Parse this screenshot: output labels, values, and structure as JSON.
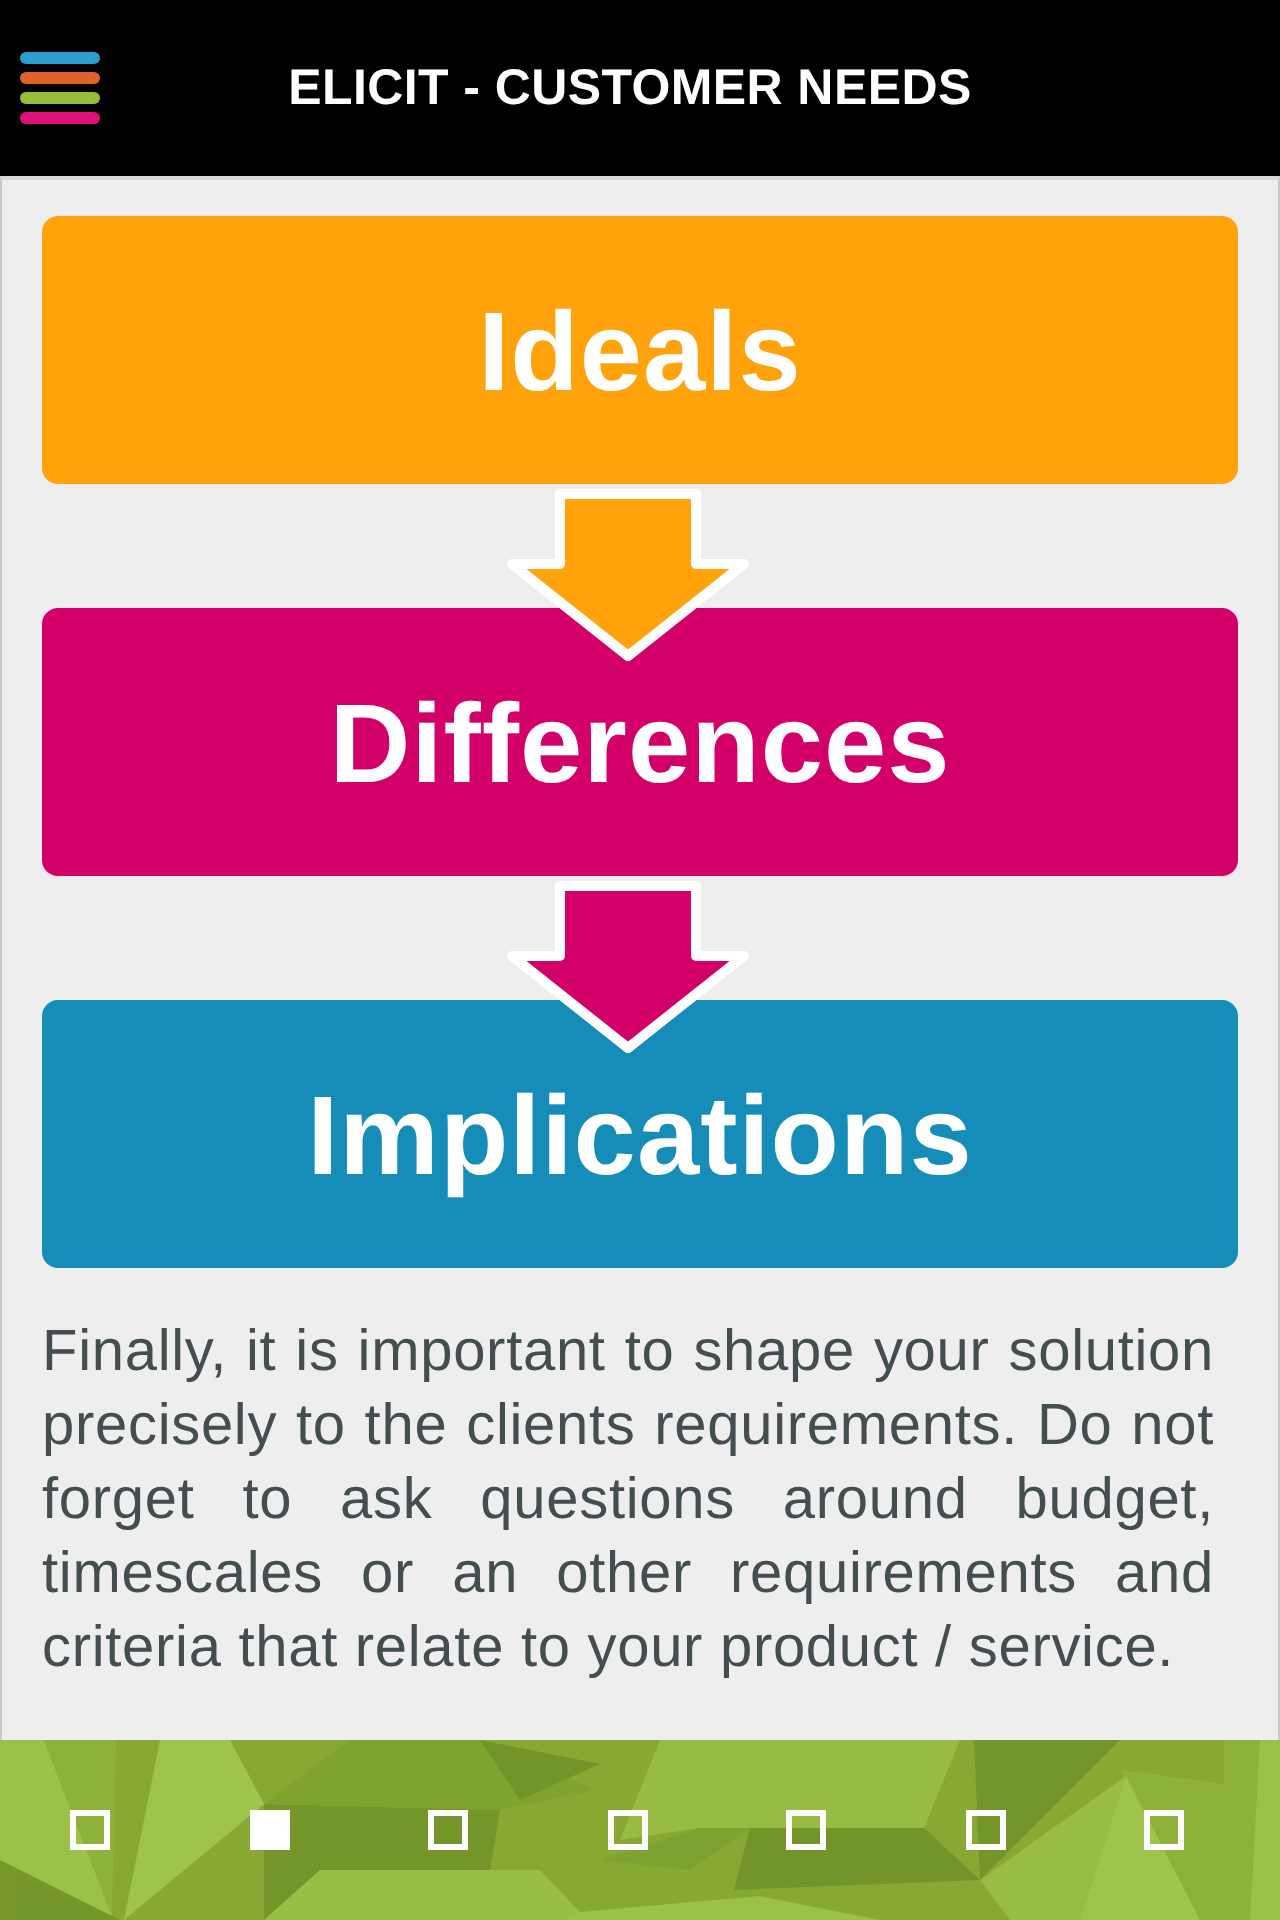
{
  "header": {
    "title": "ELICIT - CUSTOMER NEEDS"
  },
  "steps": [
    {
      "label": "Ideals",
      "color": "#ffa20c"
    },
    {
      "label": "Differences",
      "color": "#d20068"
    },
    {
      "label": "Implications",
      "color": "#168db9"
    }
  ],
  "paragraph": "Finally, it is important to shape your solution precisely to the clients requirements. Do not forget to ask questions around budget, timescales or an other requirements and criteria that relate to your product / service.",
  "pager": [
    {
      "selected": false
    },
    {
      "selected": true
    },
    {
      "selected": false
    },
    {
      "selected": false
    },
    {
      "selected": false
    },
    {
      "selected": false
    },
    {
      "selected": false
    }
  ]
}
